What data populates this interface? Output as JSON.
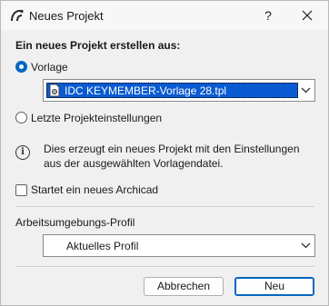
{
  "window": {
    "title": "Neues Projekt",
    "help_label": "?",
    "icon": "archicad-logo-icon",
    "close_icon": "close-icon"
  },
  "main": {
    "heading": "Ein neues Projekt erstellen aus:",
    "option_template": {
      "label": "Vorlage",
      "selected": true
    },
    "template_select": {
      "value": "IDC KEYMEMBER-Vorlage 28.tpl",
      "icon": "template-file-icon"
    },
    "option_last_settings": {
      "label": "Letzte Projekteinstellungen",
      "selected": false
    },
    "info": {
      "icon": "info-icon",
      "text": "Dies erzeugt ein neues Projekt mit den Einstellungen aus der ausgewählten Vorlagendatei."
    },
    "start_new_archicad": {
      "label": "Startet ein neues Archicad",
      "checked": false
    },
    "profile": {
      "label": "Arbeitsumgebungs-Profil",
      "value": "Aktuelles Profil"
    }
  },
  "buttons": {
    "cancel": "Abbrechen",
    "ok": "Neu"
  },
  "colors": {
    "accent": "#0067c0",
    "selection": "#0a5ad1"
  }
}
